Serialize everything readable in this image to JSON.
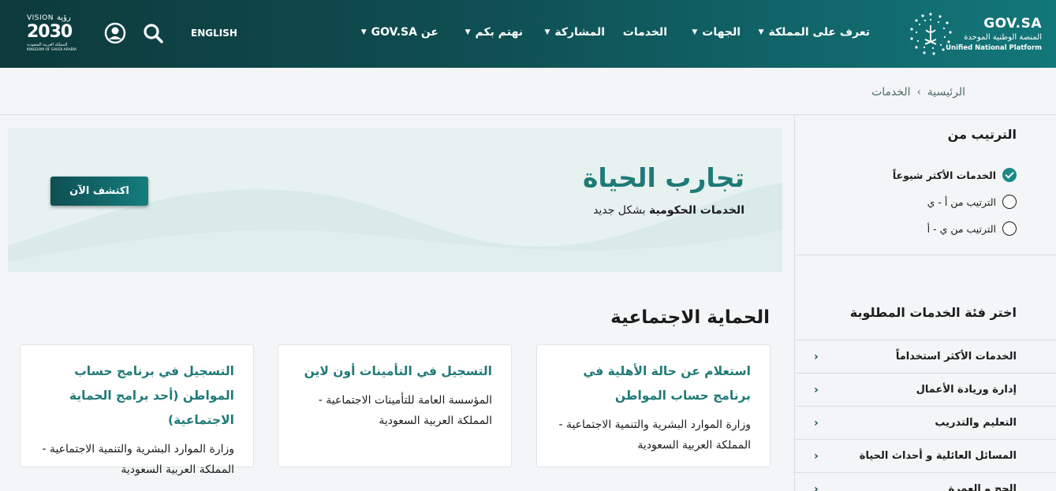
{
  "brand": {
    "name": "GOV.SA",
    "subtitle_ar": "المنصة الوطنية الموحدة",
    "subtitle_en": "Unified National Platform"
  },
  "nav": {
    "items": [
      {
        "label": "تعرف على المملكة",
        "has_dropdown": true
      },
      {
        "label": "الجهات",
        "has_dropdown": true
      },
      {
        "label": "الخدمات",
        "has_dropdown": false
      },
      {
        "label": "المشاركة",
        "has_dropdown": true
      },
      {
        "label": "نهتم بكم",
        "has_dropdown": true
      },
      {
        "label": "عن GOV.SA",
        "has_dropdown": true
      }
    ],
    "language": "ENGLISH",
    "search_icon": "search-icon",
    "user_icon": "user-icon"
  },
  "vision": {
    "line1": "VISION",
    "line1_ar": "رؤية",
    "year": "2030",
    "line3": "المملكة العربية السعودية",
    "line4": "KINGDOM OF SAUDI ARABIA"
  },
  "breadcrumb": {
    "home": "الرئيسية",
    "current": "الخدمات"
  },
  "sidebar": {
    "sort_title": "الترتيب من",
    "sort_options": [
      {
        "label": "الخدمات الأكثر شيوعاً",
        "checked": true
      },
      {
        "label": "الترتيب من أ - ي",
        "checked": false
      },
      {
        "label": "الترتيب من ي - أ",
        "checked": false
      }
    ],
    "category_title": "اختر فئة الخدمات المطلوبة",
    "categories": [
      "الخدمات الأكثر استخداماً",
      "إدارة وريادة الأعمال",
      "التعليم والتدريب",
      "المسائل العائلية و أحداث الحياة",
      "الحج و العمرة"
    ]
  },
  "banner": {
    "title": "تجارب الحياة",
    "sub_bold": "الخدمات الحكومية",
    "sub_rest": " بشكل جديد",
    "cta": "اكتشف الآن"
  },
  "section": {
    "title": "الحماية الاجتماعية",
    "cards": [
      {
        "title": "استعلام عن حالة الأهلية في برنامج حساب المواطن",
        "desc": "وزارة الموارد البشرية والتنمية الاجتماعية - المملكة العربية السعودية"
      },
      {
        "title": "التسجيل في التأمينات أون لاين",
        "desc": "المؤسسة العامة للتأمينات الاجتماعية - المملكة العربية السعودية"
      },
      {
        "title": "التسجيل في برنامج حساب المواطن (أحد برامج الحماية الاجتماعية)",
        "desc": "وزارة الموارد البشرية والتنمية الاجتماعية - المملكة العربية السعودية"
      }
    ]
  },
  "colors": {
    "header_dark": "#0d3a3c",
    "header_light": "#12777a",
    "accent": "#1f7a77"
  }
}
